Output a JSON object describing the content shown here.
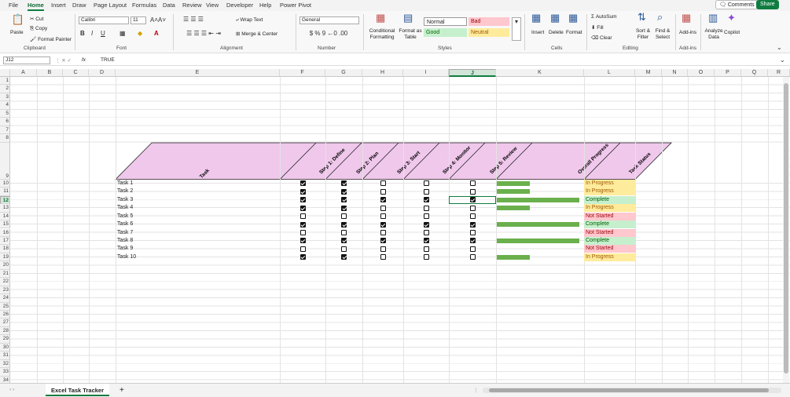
{
  "menu": {
    "items": [
      "File",
      "Home",
      "Insert",
      "Draw",
      "Page Layout",
      "Formulas",
      "Data",
      "Review",
      "View",
      "Developer",
      "Help",
      "Power Pivot"
    ],
    "comments": "Comments",
    "share": "Share"
  },
  "ribbon": {
    "clipboard": {
      "paste": "Paste",
      "cut": "Cut",
      "copy": "Copy",
      "format_painter": "Format Painter",
      "label": "Clipboard"
    },
    "font": {
      "name": "Calibri",
      "size": "11",
      "label": "Font"
    },
    "alignment": {
      "wrap": "Wrap Text",
      "merge": "Merge & Center",
      "label": "Alignment"
    },
    "number": {
      "format": "General",
      "label": "Number"
    },
    "styles": {
      "conditional": "Conditional Formatting",
      "format_table": "Format as Table",
      "normal": "Normal",
      "bad": "Bad",
      "good": "Good",
      "neutral": "Neutral",
      "label": "Styles"
    },
    "cells": {
      "insert": "Insert",
      "delete": "Delete",
      "format": "Format",
      "label": "Cells"
    },
    "editing": {
      "autosum": "AutoSum",
      "fill": "Fill",
      "clear": "Clear",
      "sort": "Sort & Filter",
      "find": "Find & Select",
      "label": "Editing"
    },
    "addins": {
      "addins": "Add-ins",
      "label": "Add-ins"
    },
    "analyze": "Analyze Data",
    "copilot": "Copilot"
  },
  "formula": {
    "cell": "J12",
    "value": "TRUE",
    "fx": "fx"
  },
  "columns": [
    "A",
    "B",
    "C",
    "D",
    "E",
    "F",
    "G",
    "H",
    "I",
    "J",
    "K",
    "L",
    "M",
    "N",
    "O",
    "P",
    "Q",
    "R"
  ],
  "rows": [
    "1",
    "2",
    "3",
    "4",
    "5",
    "6",
    "7",
    "8",
    "9",
    "10",
    "11",
    "12",
    "13",
    "14",
    "15",
    "16",
    "17",
    "18",
    "19",
    "20",
    "21",
    "22",
    "23",
    "24",
    "25",
    "26",
    "27",
    "28",
    "29",
    "30",
    "31",
    "32",
    "33",
    "34"
  ],
  "headers": [
    "Task",
    "Step 1: Define",
    "Step 2: Plan",
    "Step 3: Start",
    "Step 4: Monitor",
    "Step 5: Review",
    "Overall Progress",
    "Task Status"
  ],
  "tasks": [
    {
      "name": "Task 1",
      "steps": [
        true,
        true,
        false,
        false,
        false
      ],
      "progress": 0.4,
      "status": "In Progress"
    },
    {
      "name": "Task 2",
      "steps": [
        true,
        true,
        false,
        false,
        false
      ],
      "progress": 0.4,
      "status": "In Progress"
    },
    {
      "name": "Task 3",
      "steps": [
        true,
        true,
        true,
        true,
        true
      ],
      "progress": 1.0,
      "status": "Complete"
    },
    {
      "name": "Task 4",
      "steps": [
        true,
        true,
        false,
        false,
        false
      ],
      "progress": 0.4,
      "status": "In Progress"
    },
    {
      "name": "Task 5",
      "steps": [
        false,
        false,
        false,
        false,
        false
      ],
      "progress": 0,
      "status": "Not Started"
    },
    {
      "name": "Task 6",
      "steps": [
        true,
        true,
        true,
        true,
        true
      ],
      "progress": 1.0,
      "status": "Complete"
    },
    {
      "name": "Task 7",
      "steps": [
        false,
        false,
        false,
        false,
        false
      ],
      "progress": 0,
      "status": "Not Started"
    },
    {
      "name": "Task 8",
      "steps": [
        true,
        true,
        true,
        true,
        true
      ],
      "progress": 1.0,
      "status": "Complete"
    },
    {
      "name": "Task 9",
      "steps": [
        false,
        false,
        false,
        false,
        false
      ],
      "progress": 0,
      "status": "Not Started"
    },
    {
      "name": "Task 10",
      "steps": [
        true,
        true,
        false,
        false,
        false
      ],
      "progress": 0.4,
      "status": "In Progress"
    }
  ],
  "colors": {
    "header_fill": "#f0c8ec",
    "in_progress": "#ffeb9c",
    "complete": "#c6efce",
    "not_started": "#ffc7ce",
    "bar": "#6ab04c",
    "accent": "#107c41"
  },
  "sheet_tab": "Excel Task Tracker"
}
